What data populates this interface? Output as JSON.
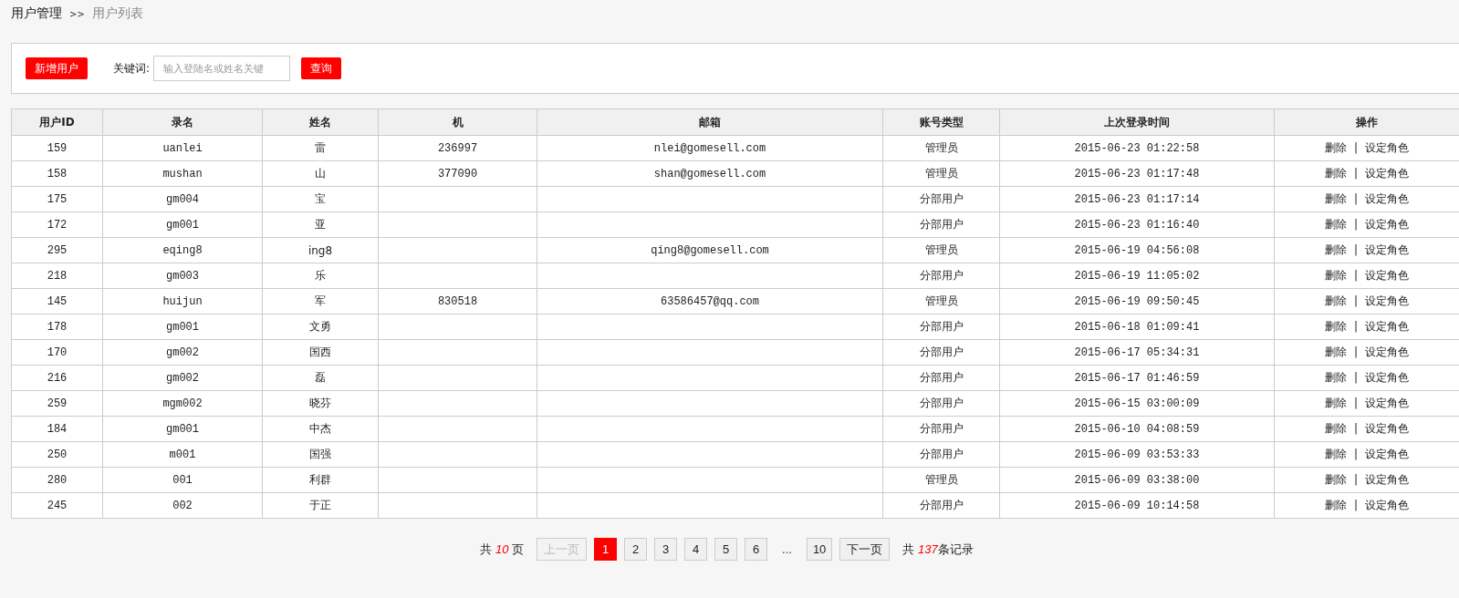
{
  "breadcrumb": {
    "parent": "用户管理",
    "separator": ">>",
    "current": "用户列表"
  },
  "toolbar": {
    "add_button": "新增用户",
    "keyword_label": "关键词:",
    "search_field": {
      "placeholder": "输入登陆名或姓名关键"
    },
    "query_button": "查询"
  },
  "table": {
    "columns": [
      "用户ID",
      "录名",
      "姓名",
      "机",
      "邮箱",
      "账号类型",
      "上次登录时间",
      "操作"
    ],
    "rows": [
      {
        "id": "159",
        "login": "uanlei",
        "name": "雷",
        "phone": "236997",
        "email": "nlei@gomesell.com",
        "type": "管理员",
        "last_login": "2015-06-23 01:22:58",
        "actions": [
          "删除",
          "|",
          "设定角色"
        ]
      },
      {
        "id": "158",
        "login": "mushan",
        "name": "山",
        "phone": "377090",
        "email": "shan@gomesell.com",
        "type": "管理员",
        "last_login": "2015-06-23 01:17:48",
        "actions": [
          "删除",
          "|",
          "设定角色"
        ]
      },
      {
        "id": "175",
        "login": "gm004",
        "name": "宝",
        "type": "分部用户",
        "last_login": "2015-06-23 01:17:14",
        "actions": [
          "删除",
          "|",
          "设定角色"
        ]
      },
      {
        "id": "172",
        "login": "gm001",
        "name": "亚",
        "type": "分部用户",
        "last_login": "2015-06-23 01:16:40",
        "actions": [
          "删除",
          "|",
          "设定角色"
        ]
      },
      {
        "id": "295",
        "login": "eqing8",
        "name": "ing8",
        "email": "qing8@gomesell.com",
        "type": "管理员",
        "last_login": "2015-06-19 04:56:08",
        "actions": [
          "删除",
          "|",
          "设定角色"
        ]
      },
      {
        "id": "218",
        "login": "gm003",
        "name": "乐",
        "type": "分部用户",
        "last_login": "2015-06-19 11:05:02",
        "actions": [
          "删除",
          "|",
          "设定角色"
        ]
      },
      {
        "id": "145",
        "login": "huijun",
        "name": "军",
        "phone": "830518",
        "email": "63586457@qq.com",
        "type": "管理员",
        "last_login": "2015-06-19 09:50:45",
        "actions": [
          "删除",
          "|",
          "设定角色"
        ]
      },
      {
        "id": "178",
        "login": "gm001",
        "name": "文勇",
        "type": "分部用户",
        "last_login": "2015-06-18 01:09:41",
        "actions": [
          "删除",
          "|",
          "设定角色"
        ]
      },
      {
        "id": "170",
        "login": "gm002",
        "name": "国西",
        "type": "分部用户",
        "last_login": "2015-06-17 05:34:31",
        "actions": [
          "删除",
          "|",
          "设定角色"
        ]
      },
      {
        "id": "216",
        "login": "gm002",
        "name": "磊",
        "type": "分部用户",
        "last_login": "2015-06-17 01:46:59",
        "actions": [
          "删除",
          "|",
          "设定角色"
        ]
      },
      {
        "id": "259",
        "login": "mgm002",
        "name": "晓芬",
        "type": "分部用户",
        "last_login": "2015-06-15 03:00:09",
        "actions": [
          "删除",
          "|",
          "设定角色"
        ]
      },
      {
        "id": "184",
        "login": "gm001",
        "name": "中杰",
        "type": "分部用户",
        "last_login": "2015-06-10 04:08:59",
        "actions": [
          "删除",
          "|",
          "设定角色"
        ]
      },
      {
        "id": "250",
        "login": "m001",
        "name": "国强",
        "type": "分部用户",
        "last_login": "2015-06-09 03:53:33",
        "actions": [
          "删除",
          "|",
          "设定角色"
        ]
      },
      {
        "id": "280",
        "login": "001",
        "name": "利群",
        "type": "管理员",
        "last_login": "2015-06-09 03:38:00",
        "actions": [
          "删除",
          "|",
          "设定角色"
        ]
      },
      {
        "id": "245",
        "login": "002",
        "name": "于正",
        "type": "分部用户",
        "last_login": "2015-06-09 10:14:58",
        "actions": [
          "删除",
          "|",
          "设定角色"
        ]
      }
    ]
  },
  "pagination": {
    "total_pages_prefix": "共",
    "total_pages": "10",
    "total_pages_suffix": "页",
    "items": [
      {
        "kind": "prev",
        "label": "上一页",
        "disabled": true
      },
      {
        "kind": "page",
        "label": "1",
        "selected": true
      },
      {
        "kind": "page",
        "label": "2",
        "selected": false
      },
      {
        "kind": "page",
        "label": "3",
        "selected": false
      },
      {
        "kind": "page",
        "label": "4",
        "selected": false
      },
      {
        "kind": "page",
        "label": "5",
        "selected": false
      },
      {
        "kind": "page",
        "label": "6",
        "selected": false
      },
      {
        "kind": "ellipsis",
        "label": "..."
      },
      {
        "kind": "page",
        "label": "10",
        "selected": false
      },
      {
        "kind": "next",
        "label": "下一页",
        "disabled": false
      }
    ],
    "total_records_prefix": "共",
    "total_records": "137",
    "total_records_suffix": "条记录"
  }
}
